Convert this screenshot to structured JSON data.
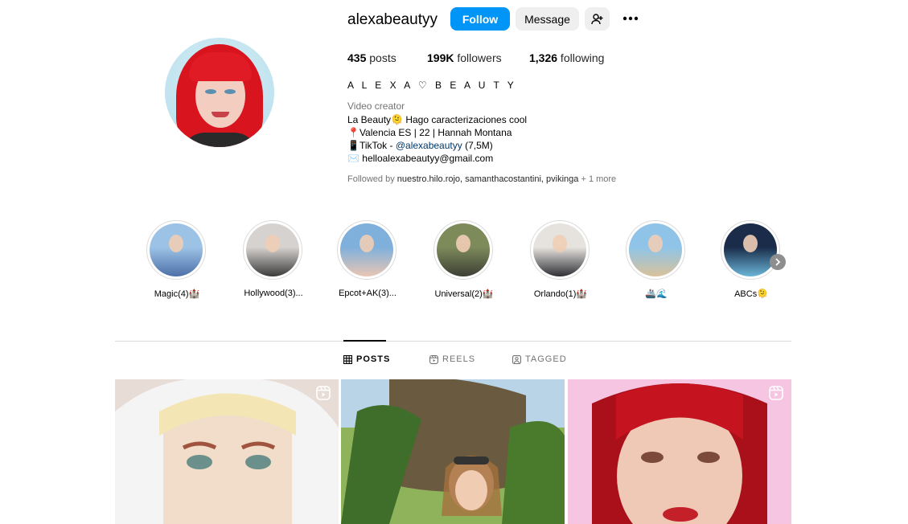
{
  "profile": {
    "username": "alexabeautyy",
    "follow_label": "Follow",
    "message_label": "Message",
    "stats": {
      "posts_count": "435",
      "posts_label": " posts",
      "followers_count": "199K",
      "followers_label": " followers",
      "following_count": "1,326",
      "following_label": " following"
    },
    "full_name": "A L E X A ♡ B E A U T Y",
    "category": "Video creator",
    "bio": [
      "La Beauty🫠 Hago caracterizaciones cool",
      "📍Valencia ES | 22 | Hannah Montana",
      "📱TikTok - ",
      "✉️ helloalexabeautyy@gmail.com"
    ],
    "tiktok_handle": "@alexabeautyy",
    "tiktok_count": " (7,5M)",
    "followed_by_prefix": "Followed by ",
    "followed_by_names": "nuestro.hilo.rojo, samanthacostantini, pvikinga",
    "followed_by_more": " + 1 more"
  },
  "highlights": [
    {
      "label": "Magic(4)🏰",
      "colors": [
        "#9cc3e6",
        "#4d6fa8"
      ]
    },
    {
      "label": "Hollywood(3)...",
      "colors": [
        "#d6d2cf",
        "#3b3b3b"
      ]
    },
    {
      "label": "Epcot+AK(3)...",
      "colors": [
        "#7fb0dc",
        "#e9c6b4"
      ]
    },
    {
      "label": "Universal(2)🏰",
      "colors": [
        "#7d8a5a",
        "#3d3f36"
      ]
    },
    {
      "label": "Orlando(1)🏰",
      "colors": [
        "#e6e3df",
        "#2f2f35"
      ]
    },
    {
      "label": "🚢🌊",
      "colors": [
        "#8fc4e8",
        "#d9c29a"
      ]
    },
    {
      "label": "ABCs🫠",
      "colors": [
        "#1a2c4a",
        "#6bb6d8"
      ]
    }
  ],
  "tabs": [
    {
      "label": "POSTS"
    },
    {
      "label": "REELS"
    },
    {
      "label": "TAGGED"
    }
  ],
  "icons": {
    "more": "more-options-icon",
    "add_user": "add-user-icon",
    "grid": "grid-icon",
    "reels": "reels-icon",
    "tagged": "tagged-icon"
  },
  "colors": {
    "accent": "#0095f6",
    "button_gray": "#efefef",
    "link": "#00376b",
    "muted": "#737373"
  }
}
